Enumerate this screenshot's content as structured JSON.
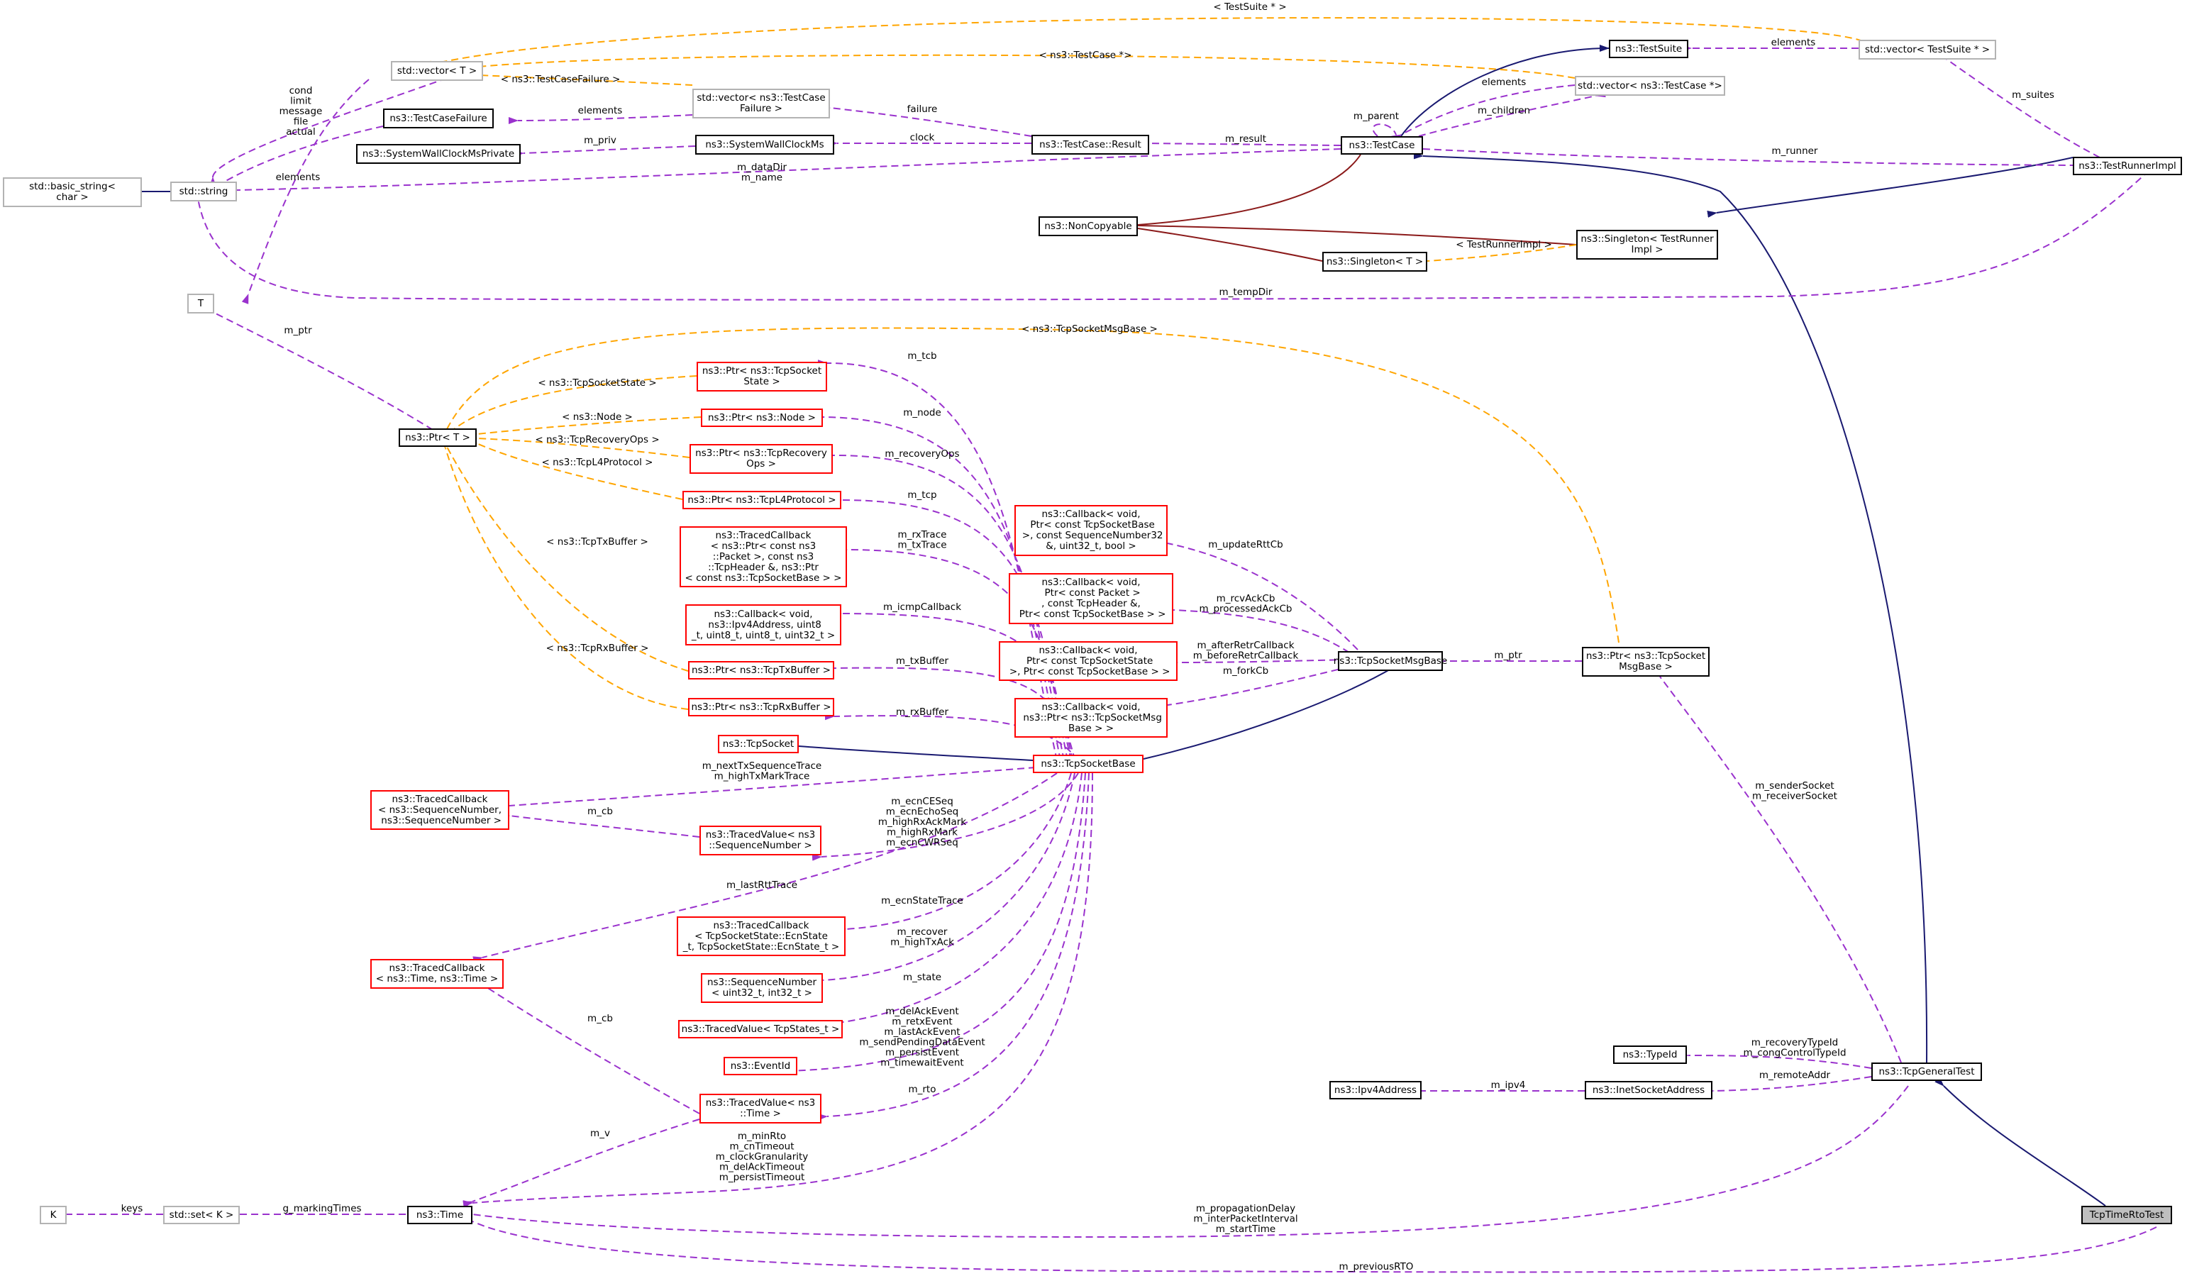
{
  "colors": {
    "inheritance": "#191970",
    "usage": "#9a32cd",
    "template": "#ffa500",
    "protected": "#8b1a1a",
    "node_border": "#000000",
    "undocumented_border": "#b3b3b3",
    "truncated_border": "#ff0000",
    "focus_fill": "#bfbfbf"
  },
  "nodes": [
    {
      "id": "std_vector_T",
      "label": "std::vector< T >"
    },
    {
      "id": "std_vector_tcf",
      "label": "std::vector< ns3::TestCase\nFailure >"
    },
    {
      "id": "tcfailure",
      "label": "ns3::TestCaseFailure"
    },
    {
      "id": "swcp",
      "label": "ns3::SystemWallClockMsPrivate"
    },
    {
      "id": "swc",
      "label": "ns3::SystemWallClockMs"
    },
    {
      "id": "tcresult",
      "label": "ns3::TestCase::Result"
    },
    {
      "id": "std_basic_string",
      "label": "std::basic_string<\nchar >"
    },
    {
      "id": "std_string",
      "label": "std::string"
    },
    {
      "id": "testcase",
      "label": "ns3::TestCase"
    },
    {
      "id": "testsuite",
      "label": "ns3::TestSuite"
    },
    {
      "id": "std_vector_tc",
      "label": "std::vector< ns3::TestCase *>"
    },
    {
      "id": "std_vector_ts",
      "label": "std::vector< TestSuite * >"
    },
    {
      "id": "testrunner",
      "label": "ns3::TestRunnerImpl"
    },
    {
      "id": "noncopyable",
      "label": "ns3::NonCopyable"
    },
    {
      "id": "singleton_tr",
      "label": "ns3::Singleton< TestRunner\nImpl >"
    },
    {
      "id": "singleton_T",
      "label": "ns3::Singleton< T >"
    },
    {
      "id": "T",
      "label": "T"
    },
    {
      "id": "ptr_T",
      "label": "ns3::Ptr< T >"
    },
    {
      "id": "ptr_tss",
      "label": "ns3::Ptr< ns3::TcpSocket\nState >"
    },
    {
      "id": "ptr_node",
      "label": "ns3::Ptr< ns3::Node >"
    },
    {
      "id": "ptr_recovery",
      "label": "ns3::Ptr< ns3::TcpRecovery\nOps >"
    },
    {
      "id": "ptr_l4",
      "label": "ns3::Ptr< ns3::TcpL4Protocol >"
    },
    {
      "id": "tcb_packet",
      "label": "ns3::TracedCallback\n< ns3::Ptr< const ns3\n::Packet >, const ns3\n::TcpHeader &, ns3::Ptr\n< const ns3::TcpSocketBase > >"
    },
    {
      "id": "cb_icmp",
      "label": "ns3::Callback< void,\n ns3::Ipv4Address, uint8\n_t, uint8_t, uint8_t, uint32_t >"
    },
    {
      "id": "ptr_txbuf",
      "label": "ns3::Ptr< ns3::TcpTxBuffer >"
    },
    {
      "id": "ptr_rxbuf",
      "label": "ns3::Ptr< ns3::TcpRxBuffer >"
    },
    {
      "id": "tcpsocket",
      "label": "ns3::TcpSocket"
    },
    {
      "id": "cb_rtt",
      "label": "ns3::Callback< void,\n Ptr< const TcpSocketBase\n >, const SequenceNumber32\n&, uint32_t, bool >"
    },
    {
      "id": "cb_rcvack",
      "label": "ns3::Callback< void,\n Ptr< const Packet >\n, const TcpHeader &,\n Ptr< const TcpSocketBase > >"
    },
    {
      "id": "cb_after",
      "label": "ns3::Callback< void,\n Ptr< const TcpSocketState\n >, Ptr< const TcpSocketBase > >"
    },
    {
      "id": "cb_fork",
      "label": "ns3::Callback< void,\n ns3::Ptr< ns3::TcpSocketMsg\nBase > >"
    },
    {
      "id": "msgbase",
      "label": "ns3::TcpSocketMsgBase"
    },
    {
      "id": "ptr_msgbase",
      "label": "ns3::Ptr< ns3::TcpSocket\nMsgBase >"
    },
    {
      "id": "socketbase",
      "label": "ns3::TcpSocketBase"
    },
    {
      "id": "tcb_seq",
      "label": "ns3::TracedCallback\n< ns3::SequenceNumber,\n ns3::SequenceNumber >"
    },
    {
      "id": "tv_seq",
      "label": "ns3::TracedValue< ns3\n::SequenceNumber >"
    },
    {
      "id": "tcb_ecn",
      "label": "ns3::TracedCallback\n< TcpSocketState::EcnState\n_t, TcpSocketState::EcnState_t >"
    },
    {
      "id": "tcb_time",
      "label": "ns3::TracedCallback\n< ns3::Time, ns3::Time >"
    },
    {
      "id": "seqnum",
      "label": "ns3::SequenceNumber\n< uint32_t, int32_t >"
    },
    {
      "id": "tv_states",
      "label": "ns3::TracedValue< TcpStates_t >"
    },
    {
      "id": "eventid",
      "label": "ns3::EventId"
    },
    {
      "id": "tv_time",
      "label": "ns3::TracedValue< ns3\n::Time >"
    },
    {
      "id": "time",
      "label": "ns3::Time"
    },
    {
      "id": "set_K",
      "label": "std::set< K >"
    },
    {
      "id": "K",
      "label": "K"
    },
    {
      "id": "typeid",
      "label": "ns3::TypeId"
    },
    {
      "id": "generaltest",
      "label": "ns3::TcpGeneralTest"
    },
    {
      "id": "inetaddr",
      "label": "ns3::InetSocketAddress"
    },
    {
      "id": "ipv4addr",
      "label": "ns3::Ipv4Address"
    },
    {
      "id": "rtotest",
      "label": "TcpTimeRtoTest"
    }
  ],
  "edge_labels": [
    {
      "id": "e_testsuite_tpl",
      "text": "< TestSuite * >"
    },
    {
      "id": "e_testcase_tpl",
      "text": "< ns3::TestCase *>"
    },
    {
      "id": "e_tcfailure_tpl",
      "text": "< ns3::TestCaseFailure >"
    },
    {
      "id": "e_elements_ts",
      "text": "elements"
    },
    {
      "id": "e_elements_tc",
      "text": "elements"
    },
    {
      "id": "e_children",
      "text": "m_children"
    },
    {
      "id": "e_parent",
      "text": "m_parent"
    },
    {
      "id": "e_suites",
      "text": "m_suites"
    },
    {
      "id": "e_failure",
      "text": "failure"
    },
    {
      "id": "e_elements_tcf",
      "text": "elements"
    },
    {
      "id": "e_clock",
      "text": "clock"
    },
    {
      "id": "e_priv",
      "text": "m_priv"
    },
    {
      "id": "e_result",
      "text": "m_result"
    },
    {
      "id": "e_runner",
      "text": "m_runner"
    },
    {
      "id": "e_cond",
      "text": "cond\nlimit\nmessage\nfile\nactual"
    },
    {
      "id": "e_elements_str",
      "text": "elements"
    },
    {
      "id": "e_datadir",
      "text": "m_dataDir\nm_name"
    },
    {
      "id": "e_tr_tpl",
      "text": "< TestRunnerImpl >"
    },
    {
      "id": "e_tempdir",
      "text": "m_tempDir"
    },
    {
      "id": "e_ptr",
      "text": "m_ptr"
    },
    {
      "id": "e_msgbase_tpl",
      "text": "< ns3::TcpSocketMsgBase >"
    },
    {
      "id": "e_tss_tpl",
      "text": "< ns3::TcpSocketState >"
    },
    {
      "id": "e_node_tpl",
      "text": "< ns3::Node >"
    },
    {
      "id": "e_recovery_tpl",
      "text": "< ns3::TcpRecoveryOps >"
    },
    {
      "id": "e_l4_tpl",
      "text": "< ns3::TcpL4Protocol >"
    },
    {
      "id": "e_txbuf_tpl",
      "text": "< ns3::TcpTxBuffer >"
    },
    {
      "id": "e_rxbuf_tpl",
      "text": "< ns3::TcpRxBuffer >"
    },
    {
      "id": "e_tcb",
      "text": "m_tcb"
    },
    {
      "id": "e_node",
      "text": "m_node"
    },
    {
      "id": "e_recoveryops",
      "text": "m_recoveryOps"
    },
    {
      "id": "e_tcp",
      "text": "m_tcp"
    },
    {
      "id": "e_rxtrace",
      "text": "m_rxTrace\nm_txTrace"
    },
    {
      "id": "e_icmp",
      "text": "m_icmpCallback"
    },
    {
      "id": "e_txbuffer",
      "text": "m_txBuffer"
    },
    {
      "id": "e_rxbuffer",
      "text": "m_rxBuffer"
    },
    {
      "id": "e_updatertt",
      "text": "m_updateRttCb"
    },
    {
      "id": "e_rcvack",
      "text": "m_rcvAckCb\nm_processedAckCb"
    },
    {
      "id": "e_afterretr",
      "text": "m_afterRetrCallback\nm_beforeRetrCallback"
    },
    {
      "id": "e_forkcb",
      "text": "m_forkCb"
    },
    {
      "id": "e_mptr",
      "text": "m_ptr"
    },
    {
      "id": "e_nexttx",
      "text": "m_nextTxSequenceTrace\nm_highTxMarkTrace"
    },
    {
      "id": "e_cb1",
      "text": "m_cb"
    },
    {
      "id": "e_ecnce",
      "text": "m_ecnCESeq\nm_ecnEchoSeq\nm_highRxAckMark\nm_highRxMark\nm_ecnCWRSeq"
    },
    {
      "id": "e_lastrtt",
      "text": "m_lastRttTrace"
    },
    {
      "id": "e_ecnstate",
      "text": "m_ecnStateTrace"
    },
    {
      "id": "e_recover",
      "text": "m_recover\nm_highTxAck"
    },
    {
      "id": "e_state",
      "text": "m_state"
    },
    {
      "id": "e_events",
      "text": "m_delAckEvent\nm_retxEvent\nm_lastAckEvent\nm_sendPendingDataEvent\nm_persistEvent\nm_timewaitEvent"
    },
    {
      "id": "e_rto",
      "text": "m_rto"
    },
    {
      "id": "e_cb2",
      "text": "m_cb"
    },
    {
      "id": "e_v",
      "text": "m_v"
    },
    {
      "id": "e_minrto",
      "text": "m_minRto\nm_cnTimeout\nm_clockGranularity\nm_delAckTimeout\nm_persistTimeout"
    },
    {
      "id": "e_marking",
      "text": "g_markingTimes"
    },
    {
      "id": "e_keys",
      "text": "keys"
    },
    {
      "id": "e_sender",
      "text": "m_senderSocket\nm_receiverSocket"
    },
    {
      "id": "e_recoverytype",
      "text": "m_recoveryTypeId\nm_congControlTypeId"
    },
    {
      "id": "e_remote",
      "text": "m_remoteAddr"
    },
    {
      "id": "e_ipv4",
      "text": "m_ipv4"
    },
    {
      "id": "e_propagation",
      "text": "m_propagationDelay\nm_interPacketInterval\nm_startTime"
    },
    {
      "id": "e_previousrto",
      "text": "m_previousRTO"
    }
  ]
}
